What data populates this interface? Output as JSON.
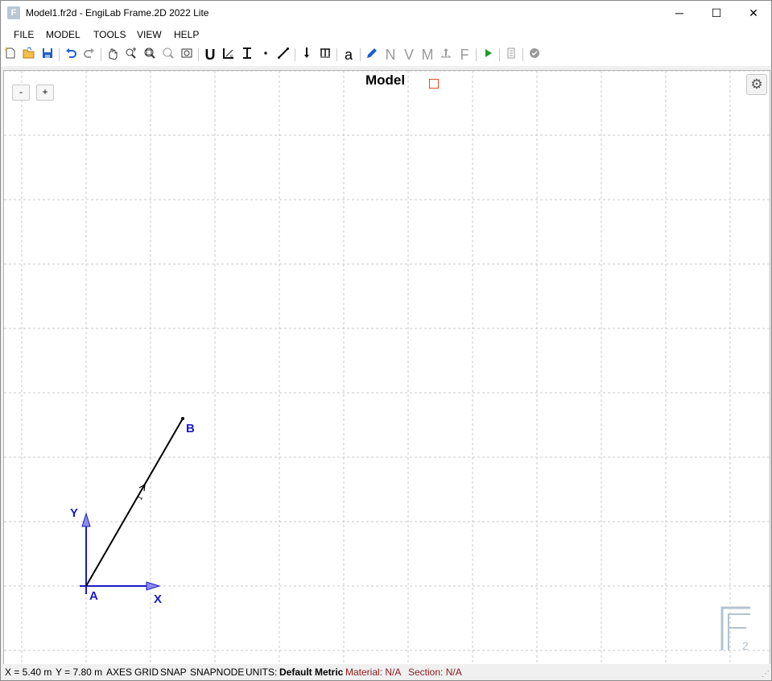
{
  "window": {
    "title": "Model1.fr2d - EngiLab Frame.2D 2022 Lite",
    "app_icon_glyph": "F",
    "controls": {
      "minimize": "─",
      "maximize": "☐",
      "close": "✕"
    }
  },
  "menu": [
    "FILE",
    "MODEL",
    "TOOLS",
    "VIEW",
    "HELP"
  ],
  "toolbar": {
    "text_buttons": {
      "u": "U",
      "n": "N",
      "v": "V",
      "m": "M",
      "f": "F",
      "a": "a"
    },
    "icons": [
      "new-file-icon",
      "open-file-icon",
      "save-icon",
      "undo-icon",
      "redo-icon",
      "pan-icon",
      "zoom-in-icon",
      "zoom-extents-icon",
      "zoom-out-icon",
      "zoom-previous-icon",
      "units-icon",
      "materials-icon",
      "sections-icon",
      "node-icon",
      "element-icon",
      "nodal-load-icon",
      "distributed-load-icon",
      "labels-icon",
      "edit-pencil-icon",
      "normal-force-icon",
      "shear-force-icon",
      "bending-moment-icon",
      "reactions-icon",
      "force-icon",
      "run-analysis-icon",
      "report-icon",
      "check-icon"
    ]
  },
  "canvas": {
    "zoom_out_label": "-",
    "zoom_in_label": "+",
    "title": "Model",
    "settings_icon": "⚙",
    "axes": {
      "x_label": "X",
      "y_label": "Y",
      "color": "#1a1ac8"
    },
    "nodes": [
      {
        "label": "A"
      },
      {
        "label": "B"
      }
    ],
    "element": {
      "number": "1"
    },
    "watermark": {
      "letter": "F",
      "subscript": "2"
    }
  },
  "status": {
    "x": "X = 5.40 m",
    "y": "Y = 7.80 m",
    "axes": "AXES",
    "grid": "GRID",
    "snap": "SNAP",
    "snapnode": "SNAPNODE",
    "units_label": "UNITS:",
    "units_value": "Default Metric",
    "material": "Material: N/A",
    "section": "Section: N/A"
  }
}
